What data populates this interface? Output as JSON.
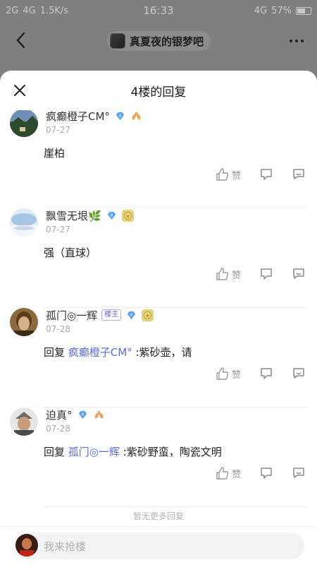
{
  "status_bar": {
    "left": [
      "2G",
      "4G",
      "1.5K/s"
    ],
    "time": "16:33",
    "network": "4G",
    "battery": "57%"
  },
  "top_bar": {
    "forum_name": "真夏夜的银梦吧",
    "back_icon": "chevron-left-icon",
    "more_icon": "more-dots-icon"
  },
  "sheet": {
    "title": "4楼的回复",
    "close_icon": "close-icon"
  },
  "replies": [
    {
      "username": "疯癫橙子CM°",
      "date": "07-27",
      "text_prefix": "",
      "mention": "",
      "text": "崖柏",
      "like_label": "赞",
      "badges": [
        "diamond-icon",
        "lungs-icon"
      ]
    },
    {
      "username": "飘雪无垠🌿",
      "date": "07-27",
      "text_prefix": "",
      "mention": "",
      "text": "强（直球）",
      "like_label": "赞",
      "badges": [
        "diamond-icon",
        "medal-icon"
      ]
    },
    {
      "username": "孤门◎一辉",
      "owner_tag": "楼主",
      "date": "07-28",
      "text_prefix": "回复",
      "mention": "疯癫橙子CM°",
      "text": ":紫砂壶，请",
      "like_label": "赞",
      "badges": [
        "level-badge",
        "diamond-icon",
        "medal-icon"
      ]
    },
    {
      "username": "迫真°",
      "date": "07-28",
      "text_prefix": "回复",
      "mention": "孤门◎一辉",
      "text": ":紫砂野蛮，陶瓷文明",
      "like_label": "赞",
      "badges": [
        "diamond-icon",
        "lungs-icon"
      ]
    }
  ],
  "no_more_text": "暂无更多回复",
  "compose": {
    "placeholder": "我来抢楼"
  },
  "colors": {
    "mention": "#5a6be0",
    "diamond": "#5aa2f5",
    "owner_tag": "#6f5bd3"
  }
}
